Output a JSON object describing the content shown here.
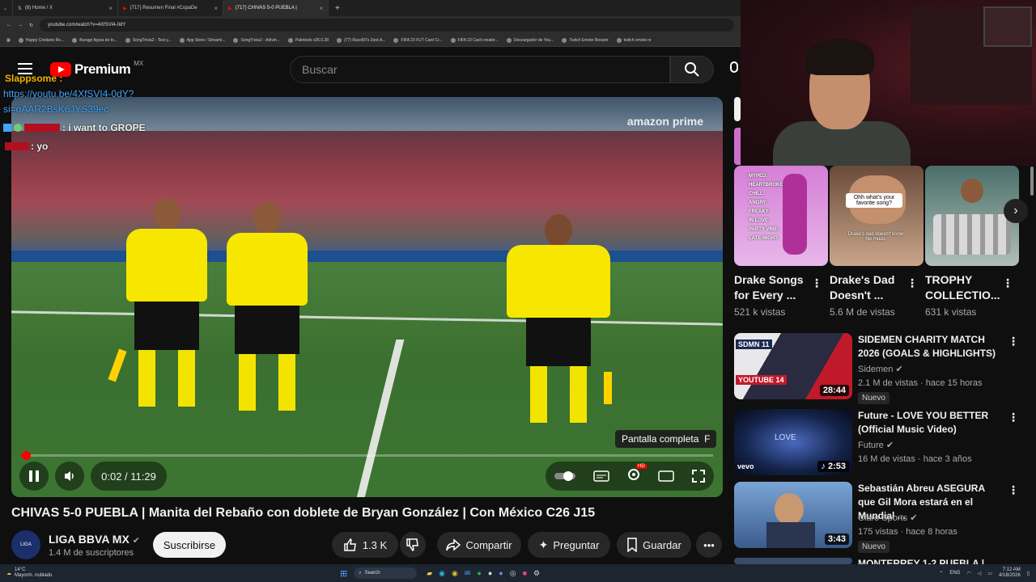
{
  "browser": {
    "tabs": [
      {
        "label": "(8) Home / X",
        "icon": "x-logo-icon"
      },
      {
        "label": "(717) Resumen Final #CopaDe",
        "icon": "youtube-icon"
      },
      {
        "label": "(717) CHIVAS 5-0 PUEBLA |",
        "icon": "youtube-icon"
      }
    ],
    "url": "youtube.com/watch?v=4XfSVI4-0dY",
    "bookmarks": [
      "Happy Cristiano Ro...",
      "Burago figura de to...",
      "SongTrivia2 - Test y...",
      "App Store / Streami...",
      "SongTrivia2 - Adivin...",
      "Paletools v26.0.28",
      "(77) Racol97s Zest-A...",
      "FIFA 23 FUT Card Cr...",
      "FIFA 23 Card creator...",
      "Descargador de You...",
      "Twitch Emote Resizer",
      "twitch emote re"
    ]
  },
  "header": {
    "logo_text": "Premium",
    "country": "MX",
    "search_placeholder": "Buscar"
  },
  "chat_overlay": {
    "line1_user": "Slappsome :",
    "line2_link": "https://youtu.be/4XfSVI4-0dY?",
    "line3_link": "si=oAAR2BsK6JYS39ec",
    "line4_text": ": i want to GROPE",
    "line5_text": ": yo"
  },
  "player": {
    "watermark": "amazon prime",
    "time": "0:02 / 11:29",
    "progress_fraction": 0.003,
    "tooltip": "Pantalla completa",
    "tooltip_key": "F",
    "hd_badge": "HD"
  },
  "video": {
    "title": "CHIVAS 5-0 PUEBLA | Manita del Rebaño con doblete de Bryan González | Con México C26 J15",
    "channel": "LIGA BBVA MX",
    "subscribers": "1.4 M de suscriptores",
    "subscribe_label": "Suscribirse",
    "likes": "1.3 K",
    "share_label": "Compartir",
    "ask_label": "Preguntar",
    "save_label": "Guardar"
  },
  "shorts": [
    {
      "title": "Drake Songs for Every ...",
      "views": "521 k vistas",
      "overlay": [
        "MYPED:",
        "HEARTBROKEN:",
        "CHILL:",
        "ANGRY:",
        "FREAKY:",
        "IN LOVE:",
        "PARTY VIBE:",
        "LATE-NIGHT:"
      ]
    },
    {
      "title": "Drake's Dad Doesn't ...",
      "views": "5.6 M de vistas",
      "overlay": [
        "Ohh what's your favorite song?",
        "Drake's dad doesn't know his music"
      ]
    },
    {
      "title": "TROPHY COLLECTIO...",
      "views": "631 k vistas",
      "overlay": []
    }
  ],
  "recommended": [
    {
      "title": "SIDEMEN CHARITY MATCH 2026 (GOALS & HIGHLIGHTS)",
      "channel": "Sidemen",
      "meta": "2.1 M de vistas · hace 15 horas",
      "duration": "28:44",
      "badge": "Nuevo",
      "thumb_text": [
        "SDMN 11",
        "YOUTUBE 14"
      ]
    },
    {
      "title": "Future - LOVE YOU BETTER (Official Music Video)",
      "channel": "Future",
      "meta": "16 M de vistas · hace 3 años",
      "duration": "2:53",
      "badge": "",
      "thumb_text": [
        "vevo",
        "LOVE"
      ]
    },
    {
      "title": "Sebastián Abreu ASEGURA que Gil Mora estará en el Mundial ...",
      "channel": "Claro Sports",
      "meta": "175 vistas · hace 8 horas",
      "duration": "3:43",
      "badge": "Nuevo",
      "thumb_text": []
    },
    {
      "title": "MONTERREY 1-2 PUEBLA | ...",
      "channel": "",
      "meta": "",
      "duration": "",
      "badge": "",
      "thumb_text": []
    }
  ],
  "taskbar": {
    "weather_temp": "14°C",
    "weather_desc": "Mayorm. nublado",
    "search_label": "Search",
    "lang": "ENG",
    "time": "7:12 AM",
    "date": "4/18/2026"
  },
  "colors": {
    "accent": "#ff0000",
    "bg": "#0f0f0f",
    "referee_shirt": "#f7e600",
    "chat_user": "#f5b400",
    "chat_link": "#3ea6ff"
  }
}
